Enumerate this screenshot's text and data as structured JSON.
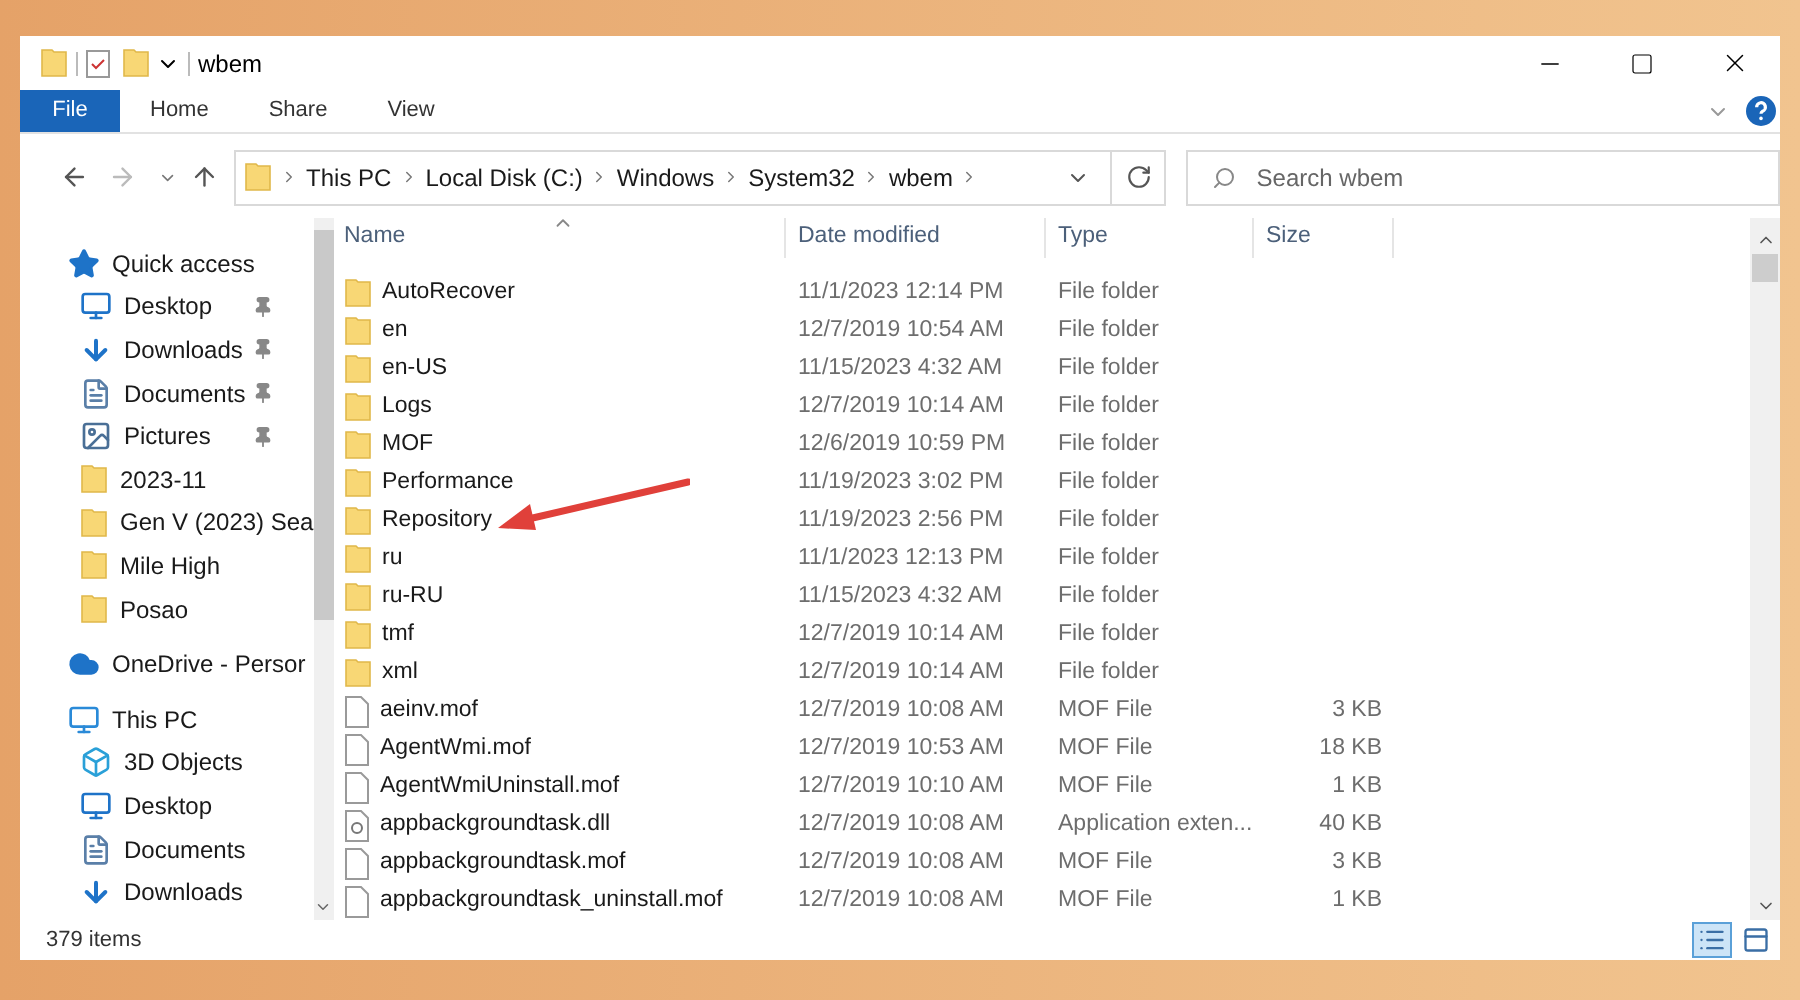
{
  "window": {
    "title": "wbem"
  },
  "ribbon": {
    "tabs": [
      {
        "label": "File",
        "selected": true
      },
      {
        "label": "Home",
        "selected": false
      },
      {
        "label": "Share",
        "selected": false
      },
      {
        "label": "View",
        "selected": false
      }
    ]
  },
  "address_bar": {
    "path": [
      "This PC",
      "Local Disk (C:)",
      "Windows",
      "System32",
      "wbem"
    ]
  },
  "search": {
    "placeholder": "Search wbem"
  },
  "sidebar": {
    "items": [
      {
        "label": "Quick access",
        "kind": "star",
        "children": [
          {
            "label": "Desktop",
            "kind": "desktop",
            "pinned": true
          },
          {
            "label": "Downloads",
            "kind": "download",
            "pinned": true
          },
          {
            "label": "Documents",
            "kind": "document",
            "pinned": true
          },
          {
            "label": "Pictures",
            "kind": "picture",
            "pinned": true
          },
          {
            "label": "2023-11",
            "kind": "folder",
            "pinned": false
          },
          {
            "label": "Gen V (2023) Sea",
            "kind": "folder",
            "pinned": false
          },
          {
            "label": "Mile High",
            "kind": "folder",
            "pinned": false
          },
          {
            "label": "Posao",
            "kind": "folder",
            "pinned": false
          }
        ]
      },
      {
        "label": "OneDrive - Persor",
        "kind": "cloud"
      },
      {
        "label": "This PC",
        "kind": "pc",
        "children": [
          {
            "label": "3D Objects",
            "kind": "objects",
            "pinned": false
          },
          {
            "label": "Desktop",
            "kind": "desktop",
            "pinned": false
          },
          {
            "label": "Documents",
            "kind": "document",
            "pinned": false
          },
          {
            "label": "Downloads",
            "kind": "download",
            "pinned": false
          }
        ]
      }
    ]
  },
  "table": {
    "columns": [
      "Name",
      "Date modified",
      "Type",
      "Size"
    ],
    "rows": [
      {
        "kind": "folder",
        "name": "AutoRecover",
        "date": "11/1/2023 12:14 PM",
        "type": "File folder"
      },
      {
        "kind": "folder",
        "name": "en",
        "date": "12/7/2019 10:54 AM",
        "type": "File folder"
      },
      {
        "kind": "folder",
        "name": "en-US",
        "date": "11/15/2023 4:32 AM",
        "type": "File folder"
      },
      {
        "kind": "folder",
        "name": "Logs",
        "date": "12/7/2019 10:14 AM",
        "type": "File folder"
      },
      {
        "kind": "folder",
        "name": "MOF",
        "date": "12/6/2019 10:59 PM",
        "type": "File folder"
      },
      {
        "kind": "folder",
        "name": "Performance",
        "date": "11/19/2023 3:02 PM",
        "type": "File folder"
      },
      {
        "kind": "folder",
        "name": "Repository",
        "date": "11/19/2023 2:56 PM",
        "type": "File folder"
      },
      {
        "kind": "folder",
        "name": "ru",
        "date": "11/1/2023 12:13 PM",
        "type": "File folder"
      },
      {
        "kind": "folder",
        "name": "ru-RU",
        "date": "11/15/2023 4:32 AM",
        "type": "File folder"
      },
      {
        "kind": "folder",
        "name": "tmf",
        "date": "12/7/2019 10:14 AM",
        "type": "File folder"
      },
      {
        "kind": "folder",
        "name": "xml",
        "date": "12/7/2019 10:14 AM",
        "type": "File folder"
      },
      {
        "kind": "file",
        "name": "aeinv.mof",
        "date": "12/7/2019 10:08 AM",
        "type": "MOF File",
        "size": "3 KB"
      },
      {
        "kind": "file",
        "name": "AgentWmi.mof",
        "date": "12/7/2019 10:53 AM",
        "type": "MOF File",
        "size": "18 KB"
      },
      {
        "kind": "file",
        "name": "AgentWmiUninstall.mof",
        "date": "12/7/2019 10:10 AM",
        "type": "MOF File",
        "size": "1 KB"
      },
      {
        "kind": "dll",
        "name": "appbackgroundtask.dll",
        "date": "12/7/2019 10:08 AM",
        "type": "Application exten...",
        "size": "40 KB"
      },
      {
        "kind": "file",
        "name": "appbackgroundtask.mof",
        "date": "12/7/2019 10:08 AM",
        "type": "MOF File",
        "size": "3 KB"
      },
      {
        "kind": "file",
        "name": "appbackgroundtask_uninstall.mof",
        "date": "12/7/2019 10:08 AM",
        "type": "MOF File",
        "size": "1 KB"
      }
    ]
  },
  "status_bar": {
    "item_count": "379 items",
    "views": [
      {
        "kind": "details",
        "selected": true
      },
      {
        "kind": "tiles",
        "selected": false
      }
    ]
  }
}
